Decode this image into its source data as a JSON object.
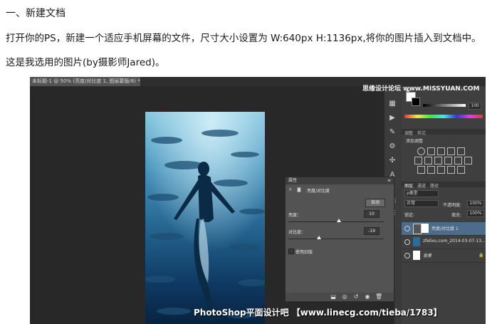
{
  "article": {
    "heading": "一、新建文档",
    "line1": "打开你的PS，新建一个适应手机屏幕的文件，尺寸大小设置为 W:640px H:1136px,将你的图片插入到文档中。",
    "line2": "这是我选用的图片(by摄影师Jared)。"
  },
  "ps": {
    "doc_tab_title": "未标题-1 @ 50% (亮度/对比度 1, 图层蒙版/8) *",
    "top_watermark": "思缘设计论坛 www.MISSYUAN.COM",
    "bottom_watermark": "PhotoShop平面设计吧 【www.linecg.com/tieba/1783】",
    "color_panel": {
      "value": "100"
    },
    "adjustments": {
      "tab1": "调整",
      "tab2": "样式",
      "title": "添加调整"
    },
    "layers": {
      "tab1": "图层",
      "tab2": "通道",
      "tab3": "路径",
      "kind": "ρ类型",
      "blend_mode": "正常",
      "opacity_label": "不透明度:",
      "opacity_value": "100%",
      "lock_label": "锁定:",
      "fill_label": "填充:",
      "fill_value": "100%",
      "items": [
        {
          "name": "亮度/对比度 1"
        },
        {
          "name": "zfelixu.com_2014-03-07-13..."
        },
        {
          "name": "背景"
        }
      ]
    },
    "properties": {
      "title": "属性",
      "subtitle": "亮度/对比度",
      "auto_label": "自动",
      "brightness_label": "亮度：",
      "brightness_value": "10",
      "contrast_label": "对比度：",
      "contrast_value": "-19",
      "legacy_label": "使用旧版"
    }
  }
}
